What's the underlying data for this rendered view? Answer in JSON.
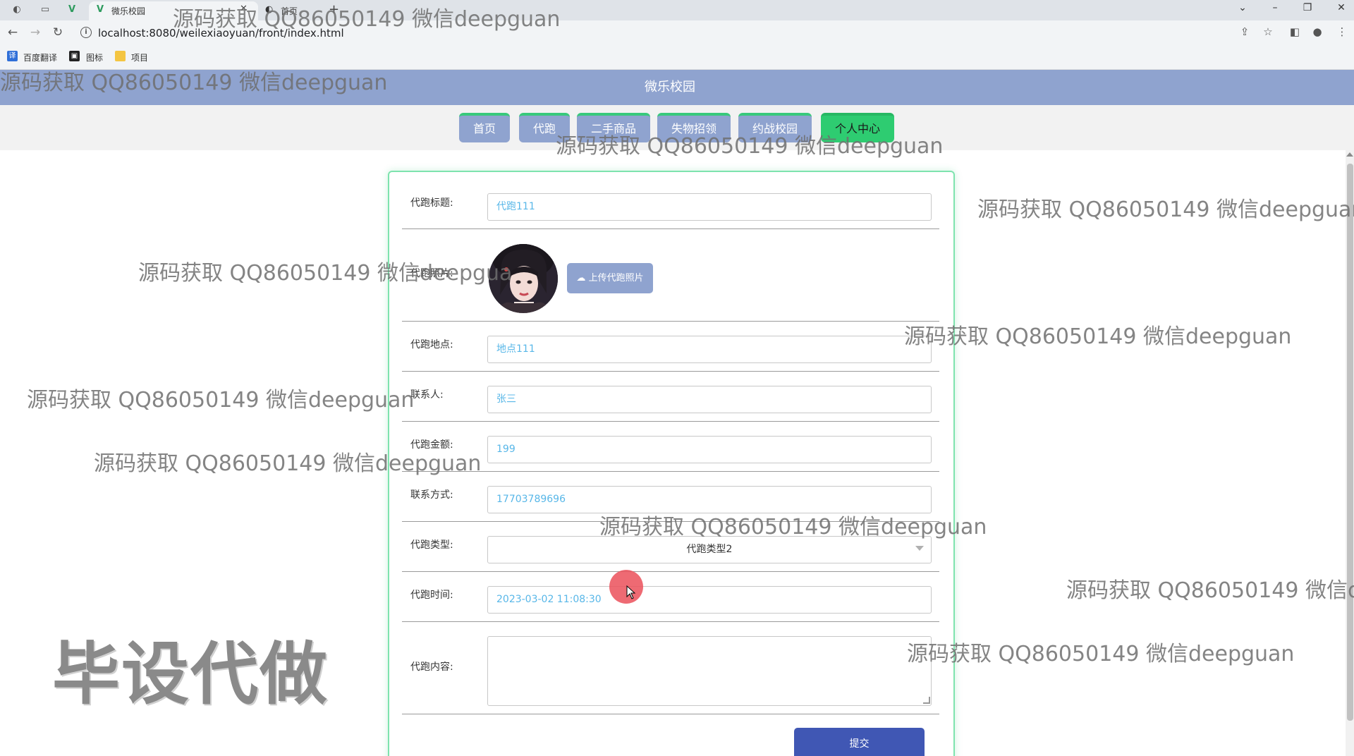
{
  "browser": {
    "tab_title": "微乐校园",
    "tab2_title": "首页",
    "url": "localhost:8080/weilexiaoyuan/front/index.html",
    "bookmarks": [
      "百度翻译",
      "图标",
      "项目"
    ]
  },
  "site": {
    "title": "微乐校园",
    "nav": [
      "首页",
      "代跑",
      "二手商品",
      "失物招领",
      "约战校园",
      "个人中心"
    ],
    "nav_active": "个人中心"
  },
  "form": {
    "fields": {
      "title": {
        "label": "代跑标题:",
        "value": "代跑111"
      },
      "photo": {
        "label": "代跑照片:",
        "upload_label": "上传代跑照片"
      },
      "location": {
        "label": "代跑地点:",
        "value": "地点111"
      },
      "contact_person": {
        "label": "联系人:",
        "value": "张三"
      },
      "amount": {
        "label": "代跑金额:",
        "value": "199"
      },
      "contact_method": {
        "label": "联系方式:",
        "value": "17703789696"
      },
      "type": {
        "label": "代跑类型:",
        "value": "代跑类型2"
      },
      "time": {
        "label": "代跑时间:",
        "value": "2023-03-02 11:08:30"
      },
      "content": {
        "label": "代跑内容:",
        "value": ""
      }
    },
    "submit_label": "提交"
  },
  "watermarks": {
    "text": "源码获取 QQ86050149 微信deepguan",
    "text_cut": "源码获取 QQ86050149 微信d",
    "text_cut2": "源码获取 QQ86050149 微信deepgua",
    "big": "毕设代做"
  },
  "colors": {
    "header": "#8fa3cf",
    "nav_active": "#2ecc71",
    "card_border": "#7ee3ae",
    "submit": "#4057b4",
    "input_text": "#58b7e8"
  }
}
